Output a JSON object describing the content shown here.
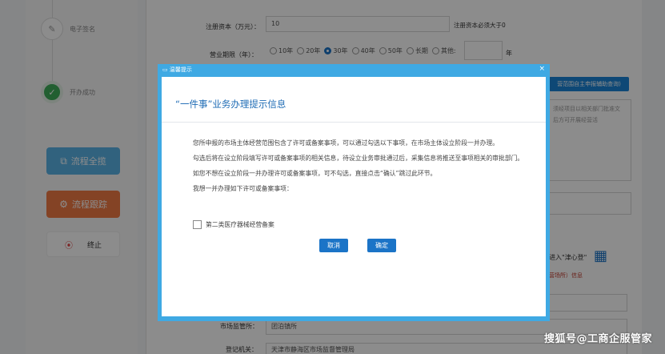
{
  "steps": [
    {
      "label": "电子签名",
      "icon": "pen-icon"
    },
    {
      "label": "开办成功",
      "icon": "check-icon"
    }
  ],
  "side_buttons": {
    "flow_overview": "流程全揽",
    "flow_track": "流程跟踪",
    "stop": "终止"
  },
  "form": {
    "capital_label": "注册资本（万元）：",
    "capital_value": "10",
    "capital_hint": "注册资本必须大于0",
    "term_label": "营业期限（年）：",
    "term_options": [
      "10年",
      "20年",
      "30年",
      "40年",
      "50年",
      "长期",
      "其他:"
    ],
    "term_selected": "30年",
    "term_unit": "年",
    "scope_button": "营范围自主申报辅助查询)",
    "scope_text_line1": "须经项目以相关部门批准文",
    "scope_text_line2": "后方可开展经营活",
    "jin_text": "进入\"津心登\"",
    "info_text": "营场所）信息",
    "regulator_label": "市场监管所：",
    "regulator_value": "团泊镇所",
    "registry_label": "登记机关：",
    "registry_value": "天津市静海区市场监督管理局"
  },
  "modal": {
    "titlebar": "温馨提示",
    "close": "×",
    "header": "“一件事”业务办理提示信息",
    "paragraphs": [
      "您所申报的市场主体经营范围包含了许可或备案事项，可以通过勾选以下事项，在市场主体设立阶段一并办理。",
      "勾选后将在设立阶段填写许可或备案事项的相关信息，待设立业务审批通过后，采集信息将推送至事项相关的审批部门。",
      "如您不想在设立阶段一并办理许可或备案事项，可不勾选，直接点击“确认”跳过此环节。",
      "我想一并办理如下许可或备案事项："
    ],
    "checkbox_label": "第二类医疗器械经营备案",
    "cancel": "取消",
    "confirm": "确定"
  },
  "watermark": "搜狐号@工商企服管家"
}
